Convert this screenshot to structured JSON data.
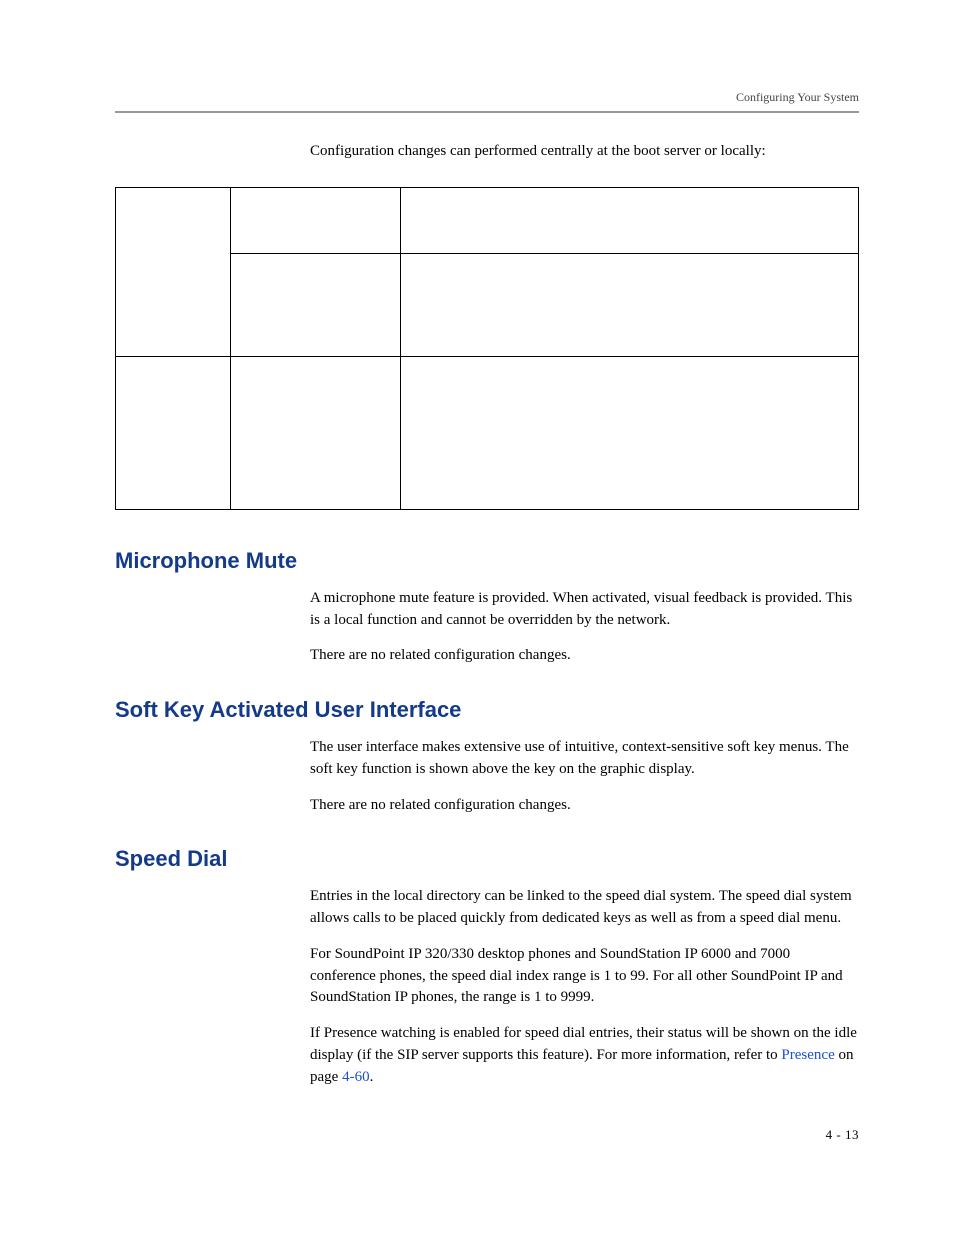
{
  "runningHead": "Configuring Your System",
  "introLine": "Configuration changes can performed centrally at the boot server or locally:",
  "sections": {
    "micMute": {
      "title": "Microphone Mute",
      "p1": "A microphone mute feature is provided. When activated, visual feedback is provided. This is a local function and cannot be overridden by the network.",
      "p2": "There are no related configuration changes."
    },
    "softKey": {
      "title": "Soft Key Activated User Interface",
      "p1": "The user interface makes extensive use of intuitive, context-sensitive soft key menus. The soft key function is shown above the key on the graphic display.",
      "p2": "There are no related configuration changes."
    },
    "speedDial": {
      "title": "Speed Dial",
      "p1": "Entries in the local directory can be linked to the speed dial system. The speed dial system allows calls to be placed quickly from dedicated keys as well as from a speed dial menu.",
      "p2": "For SoundPoint IP 320/330 desktop phones and SoundStation IP 6000 and 7000 conference phones, the speed dial index range is 1 to 99. For all other SoundPoint IP and SoundStation IP phones, the range is 1 to 9999.",
      "p3a": "If Presence watching is enabled for speed dial entries, their status will be shown on the idle display (if the SIP server supports this feature). For more information, refer to ",
      "p3link": "Presence",
      "p3mid": " on page ",
      "p3page": "4-60",
      "p3end": "."
    }
  },
  "pageNumber": "4 - 13"
}
